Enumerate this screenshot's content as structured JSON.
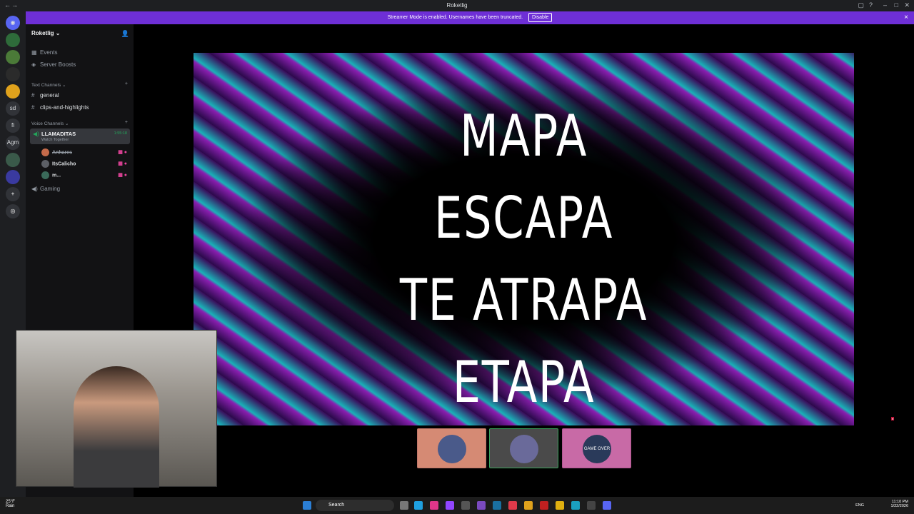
{
  "window": {
    "title": "Roketlig"
  },
  "banner": {
    "text": "Streamer Mode is enabled. Usernames have been truncated.",
    "disable_label": "Disable",
    "close_glyph": "×"
  },
  "guilds": [
    "sd",
    "fi",
    "Agm"
  ],
  "sidebar": {
    "server_name": "Roketlig",
    "nav": [
      {
        "label": "Events",
        "icon": "calendar-icon"
      },
      {
        "label": "Server Boosts",
        "icon": "boost-icon"
      }
    ],
    "text_category": "Text Channels",
    "text_channels": [
      "general",
      "clips-and-highlights"
    ],
    "voice_category": "Voice Channels",
    "active_voice": {
      "name": "LLAMADITAS",
      "activity": "Watch Together",
      "timer": "1:55:18"
    },
    "members": [
      "Anhares",
      "ItsCalicho",
      "m..."
    ],
    "other_voice": "Gaming"
  },
  "stage": {
    "lyrics": [
      "MAPA",
      "ESCAPA",
      "TE ATRAPA",
      "ETAPA"
    ]
  },
  "thumbnails": [
    {
      "bg": "#d58a74",
      "border": "#c0776a",
      "label": ""
    },
    {
      "bg": "#4a4a4a",
      "border": "#3ba55d",
      "label": ""
    },
    {
      "bg": "#c86aa6",
      "border": "#b0558f",
      "label": "GAME OVER"
    }
  ],
  "webcam": {
    "status": "Online"
  },
  "taskbar": {
    "weather_temp": "25°F",
    "weather_cond": "Rain",
    "search_label": "Search",
    "lang": "ENG",
    "time": "11:10 PM",
    "date": "1/22/2026"
  }
}
